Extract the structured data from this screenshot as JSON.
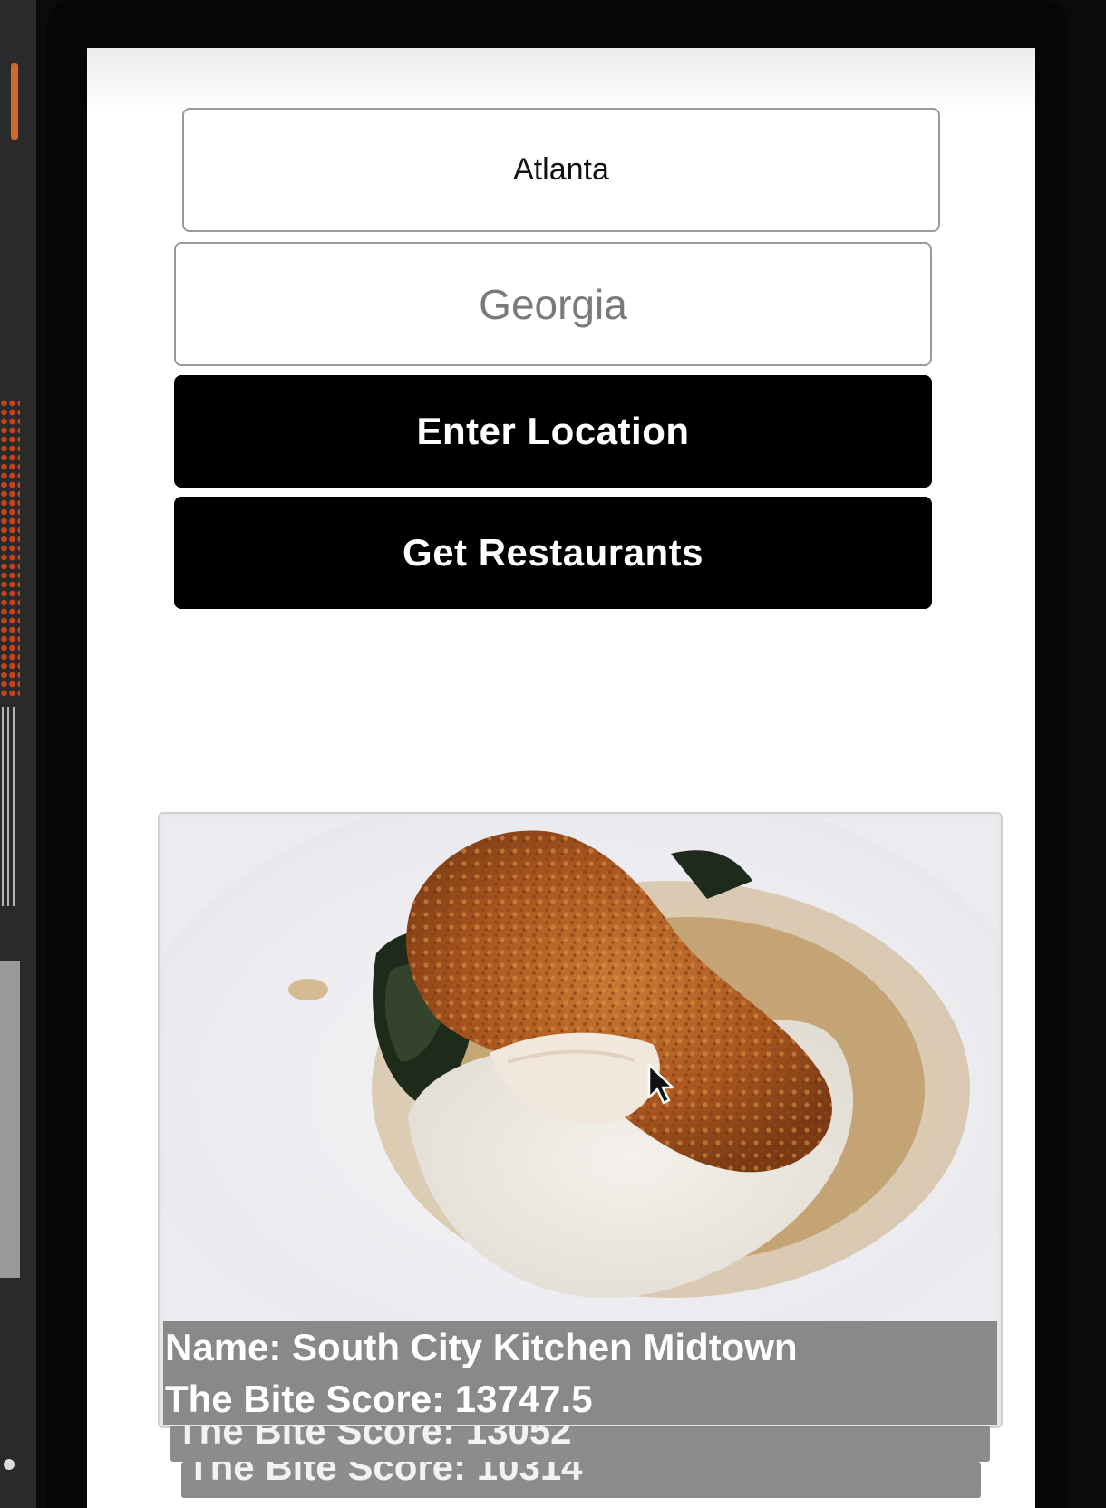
{
  "form": {
    "city_value": "Atlanta",
    "state_placeholder": "Georgia",
    "enter_location_label": "Enter Location",
    "get_restaurants_label": "Get Restaurants"
  },
  "restaurants": [
    {
      "name_line": "Name: South City Kitchen Midtown",
      "score_line": "The Bite Score: 13747.5"
    },
    {
      "score_line": "The Bite Score: 13052"
    },
    {
      "score_line": "The Bite Score: 10314"
    }
  ],
  "icons": {
    "pointer": "mouse-pointer-icon"
  },
  "colors": {
    "button_bg": "#000000",
    "button_text": "#ffffff",
    "caption_bg": "#808080",
    "field_border": "#9a9a9a",
    "placeholder_text": "#7a7a7a"
  }
}
